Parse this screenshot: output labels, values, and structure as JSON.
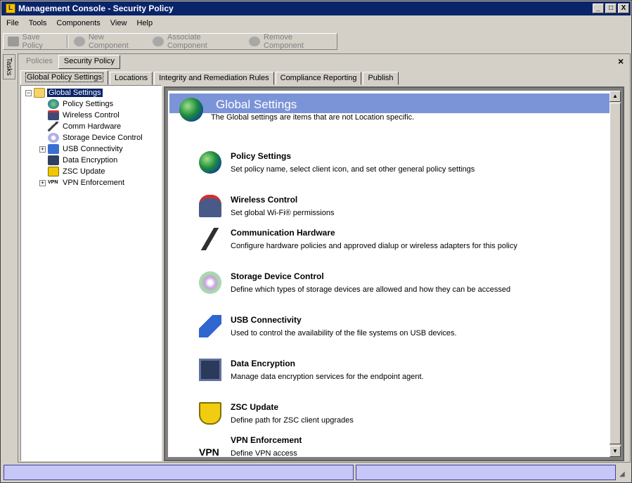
{
  "window": {
    "title": "Management Console - Security Policy",
    "app_icon_glyph": "L",
    "min_glyph": "_",
    "max_glyph": "□",
    "close_glyph": "X"
  },
  "menu": [
    "File",
    "Tools",
    "Components",
    "View",
    "Help"
  ],
  "toolbar": {
    "save_label": "Save Policy",
    "new_label": "New Component",
    "associate_label": "Associate Component",
    "remove_label": "Remove Component"
  },
  "tasks_label": "Tasks",
  "subtabs": {
    "policies": "Policies",
    "security_policy": "Security Policy",
    "close_glyph": "×"
  },
  "tabs": [
    "Global Policy Settings",
    "Locations",
    "Integrity and Remediation Rules",
    "Compliance Reporting",
    "Publish"
  ],
  "tree": {
    "root": "Global Settings",
    "items": [
      "Policy Settings",
      "Wireless Control",
      "Comm Hardware",
      "Storage Device Control",
      "USB Connectivity",
      "Data Encryption",
      "ZSC Update",
      "VPN Enforcement"
    ],
    "expand_glyph": "+",
    "collapse_glyph": "−"
  },
  "content": {
    "title": "Global Settings",
    "subtitle": "The Global settings are items that are not Location specific.",
    "items": [
      {
        "title": "Policy Settings",
        "desc": "Set policy name, select client icon, and set other general policy settings"
      },
      {
        "title": "Wireless Control",
        "desc": "Set global Wi-Fi® permissions"
      },
      {
        "title": "Communication Hardware",
        "desc": "Configure hardware policies and approved dialup or wireless adapters for this policy"
      },
      {
        "title": "Storage Device Control",
        "desc": "Define which types of storage devices are allowed and how they can be accessed"
      },
      {
        "title": "USB Connectivity",
        "desc": "Used to control the availability of the file systems on USB devices."
      },
      {
        "title": "Data Encryption",
        "desc": "Manage data encryption services for the endpoint agent."
      },
      {
        "title": "ZSC Update",
        "desc": "Define path for ZSC client upgrades"
      },
      {
        "title": "VPN Enforcement",
        "desc": "Define VPN access"
      }
    ],
    "vpn_icon_text": "VPN",
    "scroll_up_glyph": "▲",
    "scroll_down_glyph": "▼"
  },
  "colors": {
    "titlebar": "#0a246a",
    "banner": "#7b94d8",
    "selection": "#0a246a",
    "status": "#c6c6f7"
  }
}
